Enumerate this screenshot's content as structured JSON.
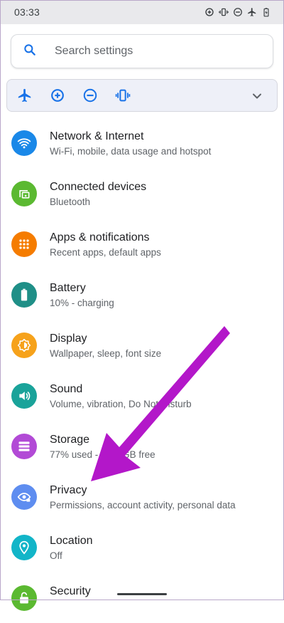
{
  "status_bar": {
    "time": "03:33",
    "icons": [
      "data-saver-icon",
      "vibrate-icon",
      "do-not-disturb-icon",
      "airplane-icon",
      "battery-charging-icon"
    ]
  },
  "search": {
    "placeholder": "Search settings",
    "icon": "search-icon"
  },
  "quick_settings": {
    "icons": [
      "airplane-icon",
      "data-saver-icon",
      "do-not-disturb-icon",
      "vibrate-icon"
    ],
    "expand_icon": "chevron-down-icon"
  },
  "settings": [
    {
      "title": "Network & Internet",
      "subtitle": "Wi-Fi, mobile, data usage and hotspot",
      "icon": "wifi-icon",
      "color": "#1a88e8"
    },
    {
      "title": "Connected devices",
      "subtitle": "Bluetooth",
      "icon": "devices-icon",
      "color": "#5bb931"
    },
    {
      "title": "Apps & notifications",
      "subtitle": "Recent apps, default apps",
      "icon": "apps-grid-icon",
      "color": "#f57c00"
    },
    {
      "title": "Battery",
      "subtitle": "10% - charging",
      "icon": "battery-icon",
      "color": "#1f8f87"
    },
    {
      "title": "Display",
      "subtitle": "Wallpaper, sleep, font size",
      "icon": "brightness-icon",
      "color": "#f6a21b"
    },
    {
      "title": "Sound",
      "subtitle": "Volume, vibration, Do Not Disturb",
      "icon": "volume-icon",
      "color": "#1aa39a"
    },
    {
      "title": "Storage",
      "subtitle": "77% used - 7.43 GB free",
      "icon": "storage-icon",
      "color": "#b24ad6"
    },
    {
      "title": "Privacy",
      "subtitle": "Permissions, account activity, personal data",
      "icon": "privacy-eye-icon",
      "color": "#5e8df0"
    },
    {
      "title": "Location",
      "subtitle": "Off",
      "icon": "location-pin-icon",
      "color": "#12b5c8"
    },
    {
      "title": "Security",
      "subtitle": "",
      "icon": "lock-icon",
      "color": "#5bb931"
    }
  ],
  "annotation": {
    "arrow_color": "#b317c9"
  },
  "colors": {
    "accent": "#1a73e8",
    "status_bar_bg": "#e9e9ec",
    "quick_bar_bg": "#eef0f8"
  }
}
